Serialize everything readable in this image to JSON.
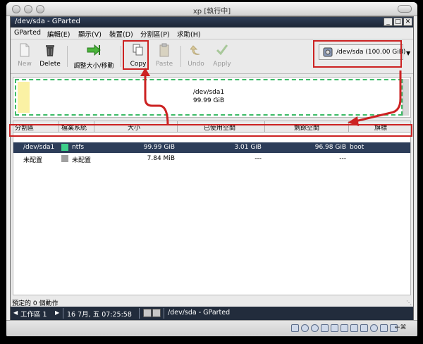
{
  "host": {
    "title": "xp [執行中]",
    "hotkey": "←⌘"
  },
  "app": {
    "title": "/dev/sda - GParted",
    "window_buttons": [
      "_",
      "□",
      "✕"
    ]
  },
  "menu": [
    {
      "label": "GParted"
    },
    {
      "label": "編輯(E)"
    },
    {
      "label": "顯示(V)"
    },
    {
      "label": "裝置(D)"
    },
    {
      "label": "分割區(P)"
    },
    {
      "label": "求助(H)"
    }
  ],
  "toolbar": {
    "new_label": "New",
    "delete_label": "Delete",
    "resize_label": "調整大小/移動",
    "copy_label": "Copy",
    "paste_label": "Paste",
    "undo_label": "Undo",
    "apply_label": "Apply",
    "device_label": "/dev/sda  (100.00 GiB)"
  },
  "visual": {
    "partition_name": "/dev/sda1",
    "partition_size": "99.99 GiB"
  },
  "table": {
    "columns": [
      "分割區",
      "檔案系統",
      "大小",
      "已使用空間",
      "剩餘空間",
      "旗標"
    ],
    "rows": [
      {
        "partition": "/dev/sda1",
        "filesystem": "ntfs",
        "size": "99.99 GiB",
        "used": "3.01 GiB",
        "unused": "96.98 GiB",
        "flags": "boot",
        "selected": true
      },
      {
        "partition": "未配置",
        "filesystem": "未配置",
        "size": "7.84 MiB",
        "used": "---",
        "unused": "---",
        "flags": "",
        "selected": false
      }
    ]
  },
  "status": {
    "pending_ops": "預定的 0 個動作"
  },
  "taskbar": {
    "workspace": "工作區 1",
    "clock": "16 7月, 五 07:25:58",
    "window": "/dev/sda - GParted"
  },
  "colors": {
    "ntfs": "#3dd08a",
    "unallocated": "#a0a0a0",
    "selection": "#2d3d59",
    "annotation": "#cc2222",
    "partition_border": "#3dbb67"
  }
}
